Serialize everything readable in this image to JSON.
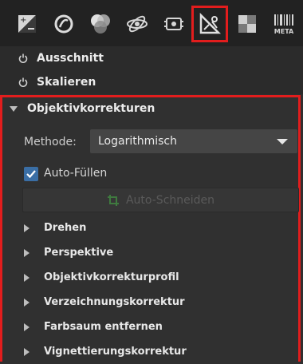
{
  "toolbar": {
    "tabs": [
      {
        "name": "exposure-tool-icon"
      },
      {
        "name": "detail-tool-icon"
      },
      {
        "name": "color-tool-icon"
      },
      {
        "name": "advanced-tool-icon"
      },
      {
        "name": "raw-tool-icon"
      },
      {
        "name": "transform-tool-icon",
        "active": true
      },
      {
        "name": "checker-tool-icon"
      },
      {
        "name": "metadata-tool-icon",
        "label": "META"
      }
    ]
  },
  "sections": {
    "crop": {
      "label": "Ausschnitt"
    },
    "resize": {
      "label": "Skalieren"
    }
  },
  "lens": {
    "title": "Objektivkorrekturen",
    "method_label": "Methode:",
    "method_value": "Logarithmisch",
    "autofill_label": "Auto-Füllen",
    "autofill_checked": true,
    "autocrop_label": "Auto-Schneiden",
    "subsections": [
      {
        "label": "Drehen"
      },
      {
        "label": "Perspektive"
      },
      {
        "label": "Objektivkorrekturprofil"
      },
      {
        "label": "Verzeichnungskorrektur"
      },
      {
        "label": "Farbsaum entfernen"
      },
      {
        "label": "Vignettierungskorrektur"
      }
    ]
  },
  "colors": {
    "highlight": "#e21d1d",
    "checkbox": "#3a6ea5"
  }
}
